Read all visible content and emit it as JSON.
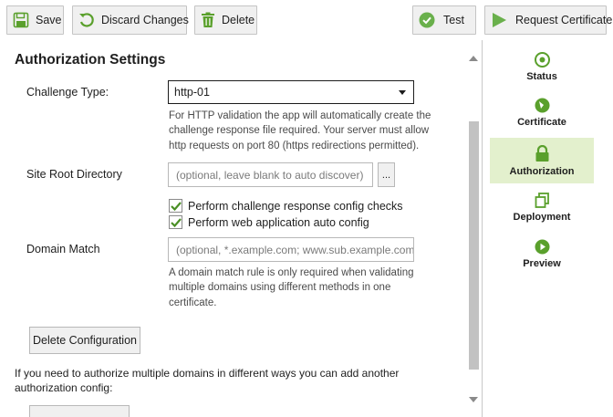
{
  "toolbar": {
    "save": "Save",
    "discard": "Discard Changes",
    "delete": "Delete",
    "test": "Test",
    "request": "Request Certificate"
  },
  "section_title": "Authorization Settings",
  "challenge": {
    "label": "Challenge Type:",
    "value": "http-01",
    "help_lines": [
      "For HTTP validation the app will automatically create the",
      "challenge response file required. Your server must allow",
      "http requests on port 80 (https redirections permitted)."
    ]
  },
  "site_root": {
    "label": "Site Root Directory",
    "placeholder": "(optional, leave blank to auto discover)",
    "browse": "..."
  },
  "checks": [
    {
      "label": "Perform challenge response config checks",
      "checked": true
    },
    {
      "label": "Perform web application auto config",
      "checked": true
    }
  ],
  "domain_match": {
    "label": "Domain Match",
    "placeholder": "(optional, *.example.com; www.sub.example.com",
    "help_lines": [
      "A domain match rule is only required when validating",
      "multiple domains using different methods in one",
      "certificate."
    ]
  },
  "delete_config": "Delete Configuration",
  "footer_lines": [
    "If you need to authorize multiple domains in different ways you can add another",
    "authorization config:"
  ],
  "nav": [
    {
      "label": "Status",
      "icon": "status-icon"
    },
    {
      "label": "Certificate",
      "icon": "certificate-icon"
    },
    {
      "label": "Authorization",
      "icon": "lock-icon",
      "selected": true
    },
    {
      "label": "Deployment",
      "icon": "deployment-icon"
    },
    {
      "label": "Preview",
      "icon": "play-icon"
    }
  ],
  "colors": {
    "accent": "#6ab04c",
    "selected_nav": "#e3f0cd"
  }
}
